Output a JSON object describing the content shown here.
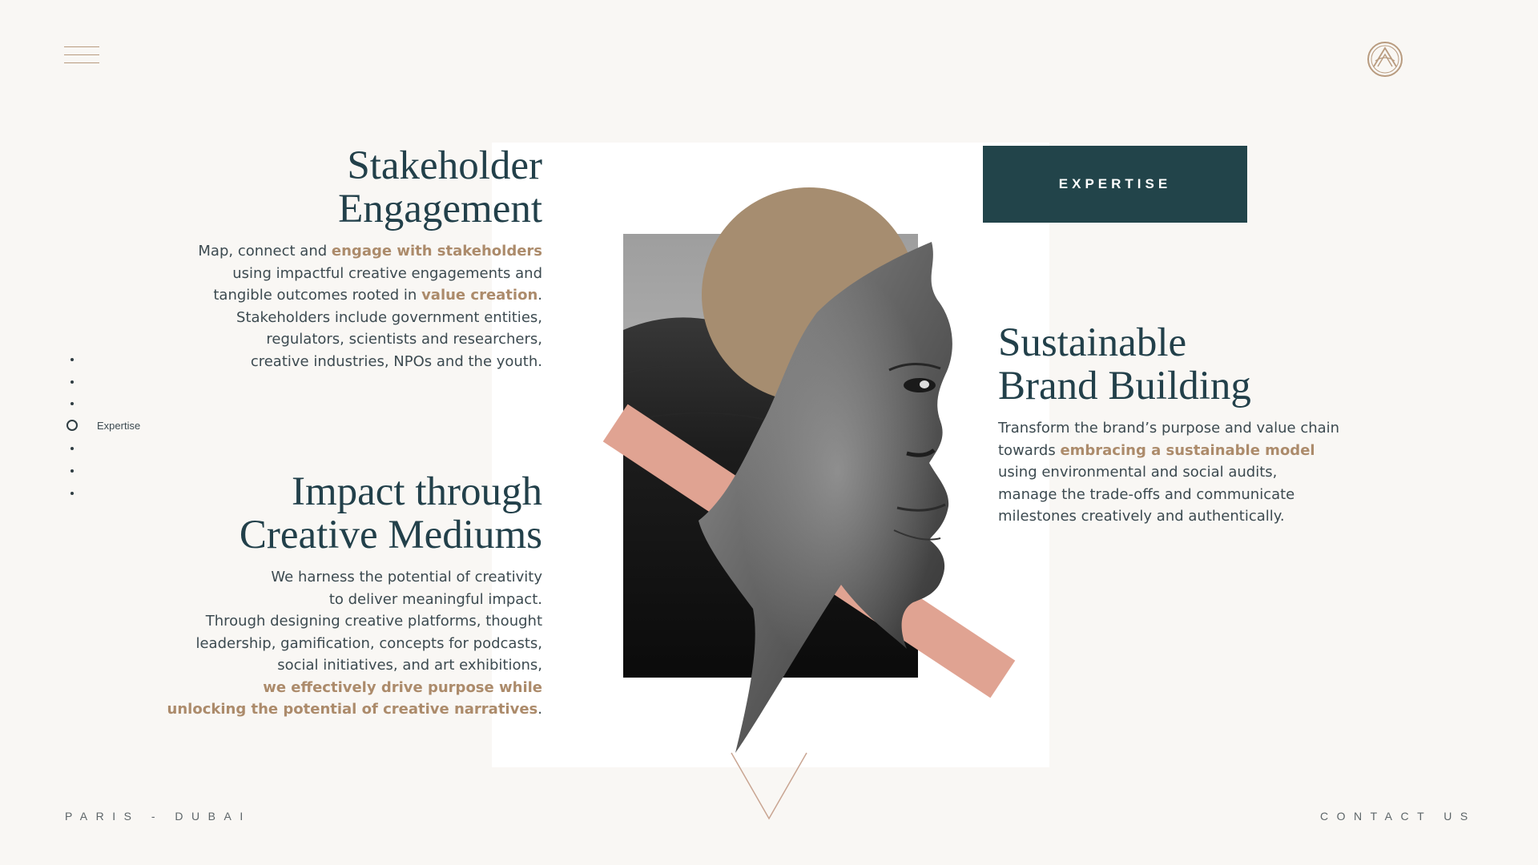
{
  "header": {
    "menu_icon": "hamburger-menu-icon",
    "logo_icon": "monogram-logo-icon"
  },
  "badge": {
    "label": "EXPERTISE"
  },
  "sections": {
    "stakeholder": {
      "title_line1": "Stakeholder",
      "title_line2": "Engagement",
      "text": {
        "l1_a": "Map, connect and ",
        "l1_accent": "engage with stakeholders",
        "l2": "using impactful creative engagements and",
        "l3_a": "tangible outcomes rooted in ",
        "l3_accent": "value creation",
        "l3_b": ".",
        "l4": "Stakeholders include government entities,",
        "l5": "regulators, scientists and researchers,",
        "l6": "creative industries, NPOs and the youth."
      }
    },
    "impact": {
      "title_line1": "Impact through",
      "title_line2": "Creative Mediums",
      "text": {
        "l1": "We harness the potential of creativity",
        "l2": "to deliver meaningful impact.",
        "l3": "Through designing creative platforms, thought",
        "l4": "leadership, gamification, concepts for podcasts,",
        "l5": "social initiatives, and art exhibitions,",
        "l6_accent": "we effectively drive purpose while",
        "l7_accent": "unlocking the potential of creative narratives",
        "l7_b": "."
      }
    },
    "brand": {
      "title_line1": "Sustainable",
      "title_line2": "Brand Building",
      "text": {
        "l1": "Transform the brand’s purpose and value chain",
        "l2_a": "towards ",
        "l2_accent": "embracing a sustainable model",
        "l3": "using environmental and social audits,",
        "l4": "manage the trade-offs and communicate",
        "l5": "milestones creatively and authentically."
      }
    }
  },
  "side_nav": {
    "active_label": "Expertise",
    "dot_count": 7,
    "active_index": 3
  },
  "footer": {
    "location": "PARIS - DUBAI",
    "contact": "CONTACT US"
  },
  "colors": {
    "background": "#f9f7f4",
    "heading": "#22404a",
    "accent": "#ac8b6b",
    "badge": "#22444a",
    "sun": "#a68d70",
    "band": "#e0a392"
  }
}
